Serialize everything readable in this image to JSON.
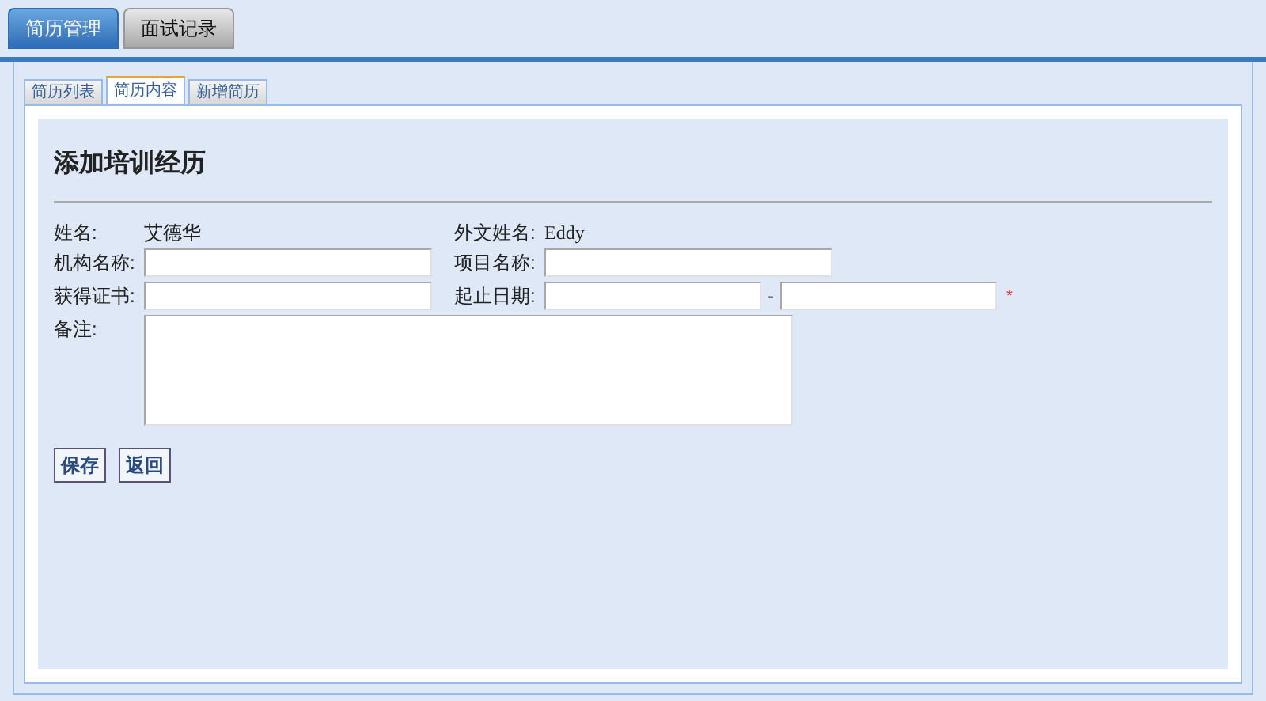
{
  "main_tabs": [
    {
      "label": "简历管理",
      "selected": true
    },
    {
      "label": "面试记录",
      "selected": false
    }
  ],
  "sub_tabs": [
    {
      "label": "简历列表",
      "selected": false
    },
    {
      "label": "简历内容",
      "selected": true
    },
    {
      "label": "新增简历",
      "selected": false
    }
  ],
  "heading": "添加培训经历",
  "form": {
    "name_label": "姓名:",
    "name_value": "艾德华",
    "foreign_name_label": "外文姓名:",
    "foreign_name_value": "Eddy",
    "org_label": "机构名称:",
    "project_label": "项目名称:",
    "cert_label": "获得证书:",
    "date_label": "起止日期:",
    "date_separator": "-",
    "required_mark": "*",
    "note_label": "备注:"
  },
  "buttons": [
    "保存",
    "返回"
  ]
}
